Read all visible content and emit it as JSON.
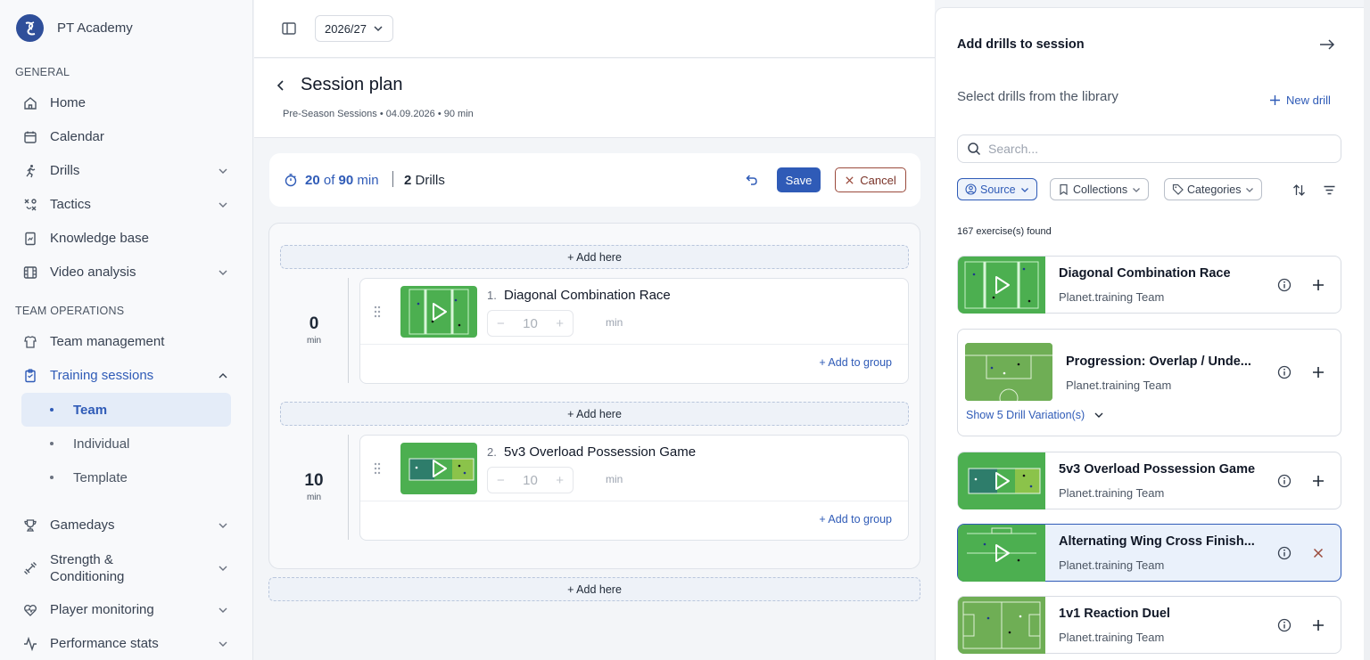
{
  "app": {
    "name": "PT Academy"
  },
  "sidebar": {
    "sections": {
      "general": "GENERAL",
      "team_ops": "TEAM OPERATIONS"
    },
    "general_items": [
      {
        "label": "Home",
        "icon": "home-icon"
      },
      {
        "label": "Calendar",
        "icon": "calendar-icon"
      },
      {
        "label": "Drills",
        "icon": "running-icon"
      },
      {
        "label": "Tactics",
        "icon": "tactics-icon"
      },
      {
        "label": "Knowledge base",
        "icon": "book-icon"
      },
      {
        "label": "Video analysis",
        "icon": "film-icon"
      }
    ],
    "team_items": [
      {
        "label": "Team management",
        "icon": "team-icon"
      },
      {
        "label": "Training sessions",
        "icon": "clipboard-icon"
      }
    ],
    "training_sub": [
      "Team",
      "Individual",
      "Template"
    ],
    "more_items": [
      {
        "label": "Gamedays",
        "icon": "trophy-icon"
      },
      {
        "label": "Strength &\nConditioning",
        "icon": "dumbbell-icon"
      },
      {
        "label": "Player monitoring",
        "icon": "heart-pulse-icon"
      },
      {
        "label": "Performance stats",
        "icon": "activity-icon"
      }
    ]
  },
  "topbar": {
    "season": "2026/27"
  },
  "header": {
    "title": "Session plan",
    "subtitle": "Pre-Season Sessions • 04.09.2026 • 90 min"
  },
  "summary": {
    "used": "20",
    "of": "of",
    "total": "90",
    "unit": "min",
    "drills_count": "2",
    "drills_label": "Drills",
    "save": "Save",
    "cancel": "Cancel"
  },
  "plan": {
    "add_here": "+ Add here",
    "add_to_group": "+ Add to group",
    "min_unit": "min",
    "groups": [
      {
        "start": "0",
        "number": "1.",
        "name": "Diagonal Combination Race",
        "duration": "10"
      },
      {
        "start": "10",
        "number": "2.",
        "name": "5v3 Overload Possession Game",
        "duration": "10"
      }
    ]
  },
  "library": {
    "title": "Add drills to session",
    "subtitle": "Select drills from the library",
    "new_drill": "New drill",
    "search_placeholder": "Search...",
    "filters": [
      "Source",
      "Collections",
      "Categories"
    ],
    "found": "167 exercise(s) found",
    "items": [
      {
        "name": "Diagonal Combination Race",
        "team": "Planet.training Team",
        "selected": false
      },
      {
        "name": "Progression: Overlap / Unde...",
        "team": "Planet.training Team",
        "selected": false,
        "variations": "Show 5 Drill Variation(s)"
      },
      {
        "name": "5v3 Overload Possession Game",
        "team": "Planet.training Team",
        "selected": false
      },
      {
        "name": "Alternating Wing Cross Finish...",
        "team": "Planet.training Team",
        "selected": true
      },
      {
        "name": "1v1 Reaction Duel",
        "team": "Planet.training Team",
        "selected": false
      }
    ]
  },
  "colors": {
    "accent": "#2f5bb7",
    "pitch": "#4caf50",
    "cancel": "#9a4a3c"
  }
}
